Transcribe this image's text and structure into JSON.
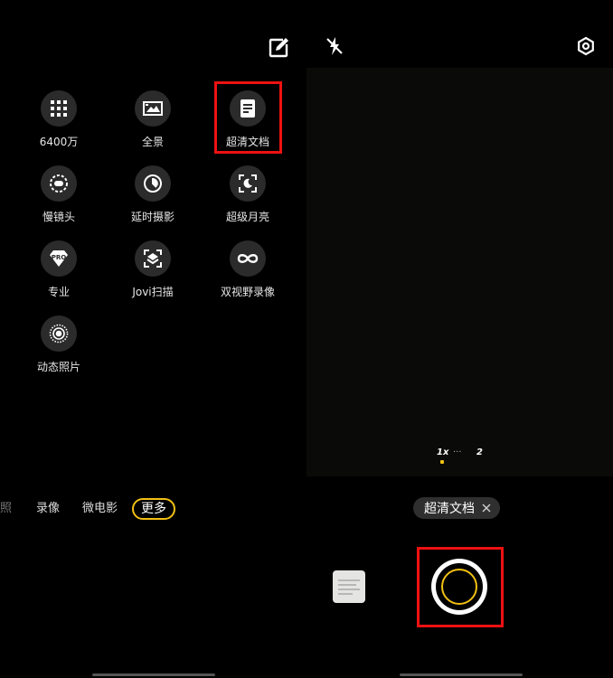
{
  "more_modes": {
    "items": [
      {
        "label": "6400万",
        "icon": "grid-icon"
      },
      {
        "label": "全景",
        "icon": "panorama-icon"
      },
      {
        "label": "超清文档",
        "icon": "document-icon"
      },
      {
        "label": "慢镜头",
        "icon": "slow-motion-icon"
      },
      {
        "label": "延时摄影",
        "icon": "timelapse-icon"
      },
      {
        "label": "超级月亮",
        "icon": "moon-icon"
      },
      {
        "label": "专业",
        "icon": "pro-icon"
      },
      {
        "label": "Jovi扫描",
        "icon": "scan-icon"
      },
      {
        "label": "双视野录像",
        "icon": "dual-view-icon"
      },
      {
        "label": "动态照片",
        "icon": "live-photo-icon"
      }
    ],
    "highlighted": "超清文档"
  },
  "mode_bar": {
    "tabs": [
      "照",
      "录像",
      "微电影",
      "更多"
    ],
    "active": "更多"
  },
  "camera": {
    "zoom_levels": [
      "1x",
      "···",
      "2"
    ],
    "active_zoom": "1x",
    "mode_chip": "超清文档",
    "icons": {
      "flash": "flash-off-icon",
      "settings": "settings-icon",
      "close": "close-icon"
    }
  },
  "colors": {
    "accent": "#f2c013",
    "highlight": "#e11111",
    "background": "#000000"
  }
}
